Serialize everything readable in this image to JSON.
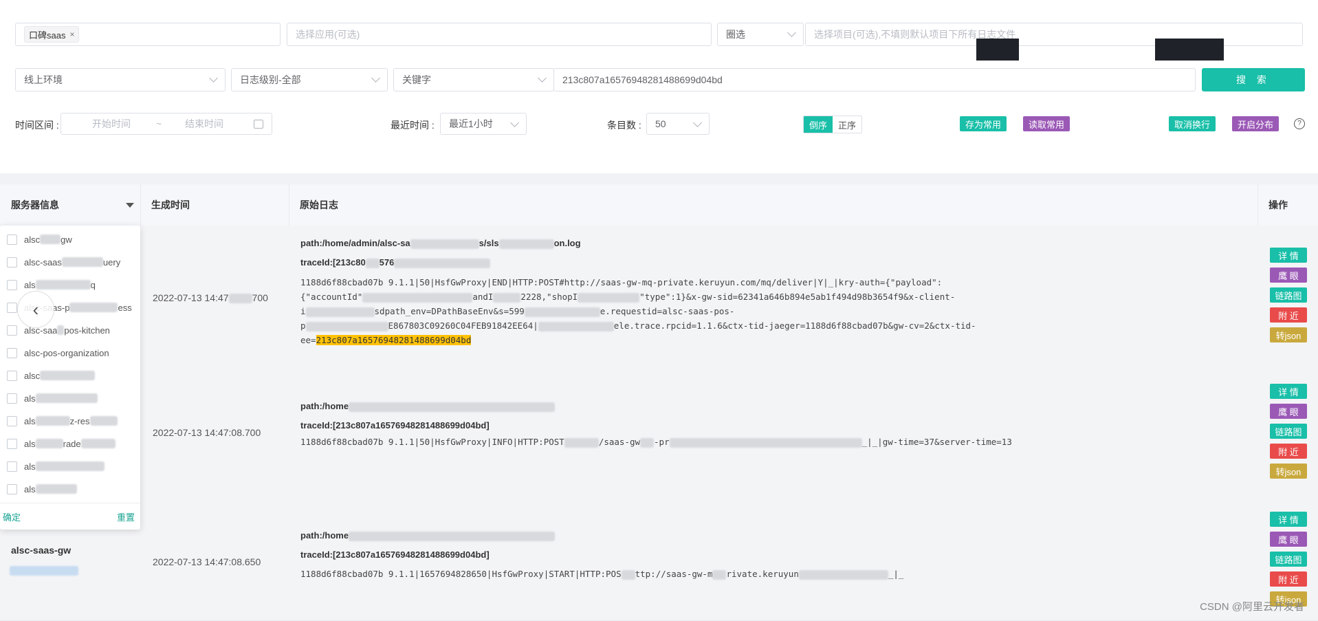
{
  "search": {
    "app_tag": "口碑saas",
    "tag_close": "×",
    "app_select_placeholder": "选择应用(可选)",
    "scope_select": "圈选",
    "project_placeholder": "选择项目(可选),不填则默认项目下所有日志文件",
    "env_select": "线上环境",
    "level_select": "日志级别-全部",
    "keyword_type": "关键字",
    "keyword_value": "213c807a16576948281488699d04bd",
    "search_button": "搜 索"
  },
  "options": {
    "time_range_label": "时间区间 :",
    "start_placeholder": "开始时间",
    "range_sep": "~",
    "end_placeholder": "结束时间",
    "recent_label": "最近时间 :",
    "recent_value": "最近1小时",
    "count_label": "条目数 :",
    "count_value": "50",
    "order_desc": "倒序",
    "order_asc": "正序",
    "save_common": "存为常用",
    "load_common": "读取常用",
    "cancel_wrap": "取消换行",
    "open_dist": "开启分布",
    "help": "?"
  },
  "table": {
    "headers": [
      "服务器信息",
      "生成时间",
      "原始日志",
      "操作"
    ],
    "rows": [
      {
        "time": "2022-07-13 14:47",
        "time_tail": "700",
        "path": "path:/home/admin/alsc-sa",
        "path_mid": "s/sls",
        "path_tail": "on.log",
        "trace": "traceId:[213c80",
        "trace_tail": "576",
        "raw1": "1188d6f88cbad07b 9.1.1|50|HsfGwProxy|END|HTTP:POST#http://saas-gw-mq-private.keruyun.com/mq/deliver|Y|_|kry-auth={\"payload\":",
        "raw2a": "{\"accountId\"",
        "raw2b": "andI",
        "raw2c": "2228,\"shopI",
        "raw2d": "\"type\":1}&x-gw-sid=62341a646b894e5ab1f494d98b3654f9&x-client-",
        "raw3a": "i",
        "raw3b": "sdpath_env=DPathBaseEnv&s=599",
        "raw3c": "e.requestid=alsc-saas-pos-",
        "raw4a": "p",
        "raw4b": "E867803C09260C04FEB91842EE64|",
        "raw4c": "ele.trace.rpcid=1.1.6&ctx-tid-jaeger=1188d6f88cbad07b&gw-cv=2&ctx-tid-",
        "raw5a": "ee=",
        "raw5hl": "213c807a16576948281488699d04bd"
      },
      {
        "time": "2022-07-13 14:47:08.700",
        "path": "path:/home",
        "trace": "traceId:[213c807a16576948281488699d04bd]",
        "raw1a": "1188d6f88cbad07b 9.1.1|50|HsfGwProxy|INFO|HTTP:POST",
        "raw1b": "/saas-gw",
        "raw1c": "-pr",
        "raw1d": "_|_|gw-time=37&server-time=13"
      },
      {
        "time": "2022-07-13 14:47:08.650",
        "path": "path:/home",
        "trace": "traceId:[213c807a16576948281488699d04bd]",
        "raw1a": "1188d6f88cbad07b 9.1.1|1657694828650|HsfGwProxy|START|HTTP:POS",
        "raw1b": "ttp://saas-gw-m",
        "raw1c": "rivate.keruyun",
        "raw1d": "_|_"
      }
    ],
    "row3_server": "alsc-saas-gw"
  },
  "ops": {
    "detail": "详 情",
    "eagle": "鹰 眼",
    "chain": "链路图",
    "near": "附 近",
    "json": "转json"
  },
  "filter_panel": {
    "items": [
      "alsc",
      "alsc-saas",
      "als",
      "alsc-saas-p",
      "alsc-saa",
      "alsc-pos-organization",
      "alsc",
      "als",
      "als",
      "als",
      "als",
      "als"
    ],
    "items_tail": [
      "gw",
      "uery",
      "q",
      "ess",
      "pos-kitchen",
      "",
      "",
      "",
      "z-res",
      "rade",
      "",
      ""
    ],
    "ok": "确定",
    "reset": "重置"
  },
  "nav": {
    "prev": "‹"
  },
  "watermark": "CSDN @阿里云开发者"
}
